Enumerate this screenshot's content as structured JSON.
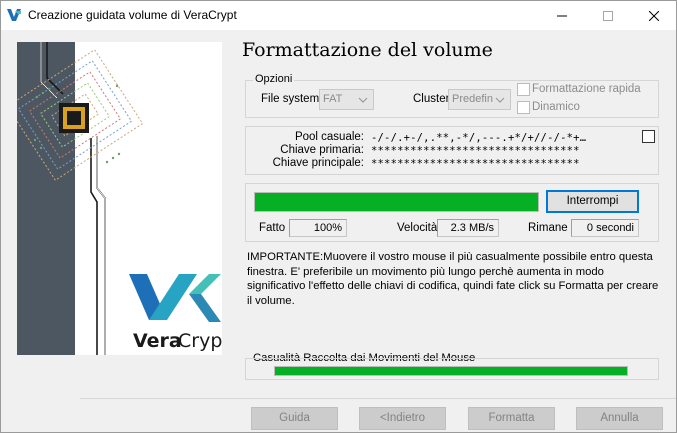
{
  "window": {
    "title": "Creazione guidata volume di VeraCrypt",
    "controls": [
      "minimize-icon",
      "maximize-icon",
      "close-icon"
    ]
  },
  "branding": {
    "logo_text_bold": "Vera",
    "logo_text_light": "Crypt",
    "accent_colors": [
      "#1d6fb8",
      "#27a3c4",
      "#44c0b8"
    ]
  },
  "page": {
    "heading": "Formattazione del volume"
  },
  "options": {
    "legend": "Opzioni",
    "filesystem_label": "File system",
    "filesystem_value": "FAT",
    "cluster_label": "Cluster",
    "cluster_value": "Predefin",
    "quick_format_label": "Formattazione rapida",
    "dynamic_label": "Dinamico"
  },
  "keys": {
    "pool_label": "Pool casuale:",
    "pool_value": "-/-/.+-/,.**,-*/,---.+*/+//-/-*+…",
    "header_key_label": "Chiave primaria:",
    "header_key_value": "********************************",
    "master_key_label": "Chiave principale:",
    "master_key_value": "********************************",
    "show_pool_checked": false
  },
  "progress": {
    "fraction": 1.0,
    "abort_label": "Interrompi",
    "done_label": "Fatto",
    "done_value": "100%",
    "speed_label": "Velocità",
    "speed_value": "2.3 MB/s",
    "left_label": "Rimane",
    "left_value": "0 secondi",
    "fill_color": "#06b025"
  },
  "notice": {
    "text": "IMPORTANTE:Muovere il vostro mouse il più casualmente possibile entro questa finestra. E' preferibile un movimento più lungo perchè aumenta in modo significativo l'effetto delle chiavi di codifica, quindi fate click su Formatta per creare il volume."
  },
  "entropy": {
    "legend": "Casualità Raccolta dai Movimenti del Mouse",
    "fraction": 1.0
  },
  "buttons": {
    "help": "Guida",
    "back": "<Indietro",
    "format": "Formatta",
    "cancel": "Annulla"
  }
}
